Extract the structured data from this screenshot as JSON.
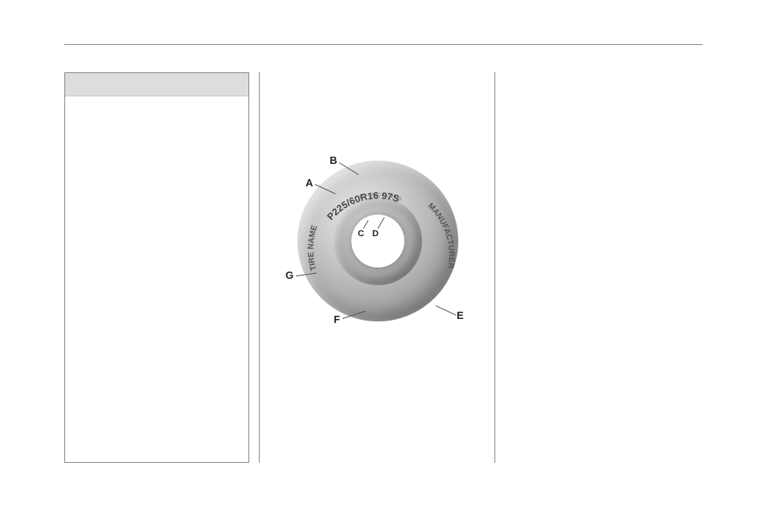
{
  "layout": {
    "box_header": ""
  },
  "diagram": {
    "labels": {
      "A": "A",
      "B": "B",
      "C": "C",
      "D": "D",
      "E": "E",
      "F": "F",
      "G": "G"
    },
    "tire_text": {
      "size_code": "P225/60R16 97S",
      "spec": "PC SPEC 1108 MS",
      "name": "TIRE NAME",
      "manufacturer": "MANUFACTURER"
    }
  }
}
